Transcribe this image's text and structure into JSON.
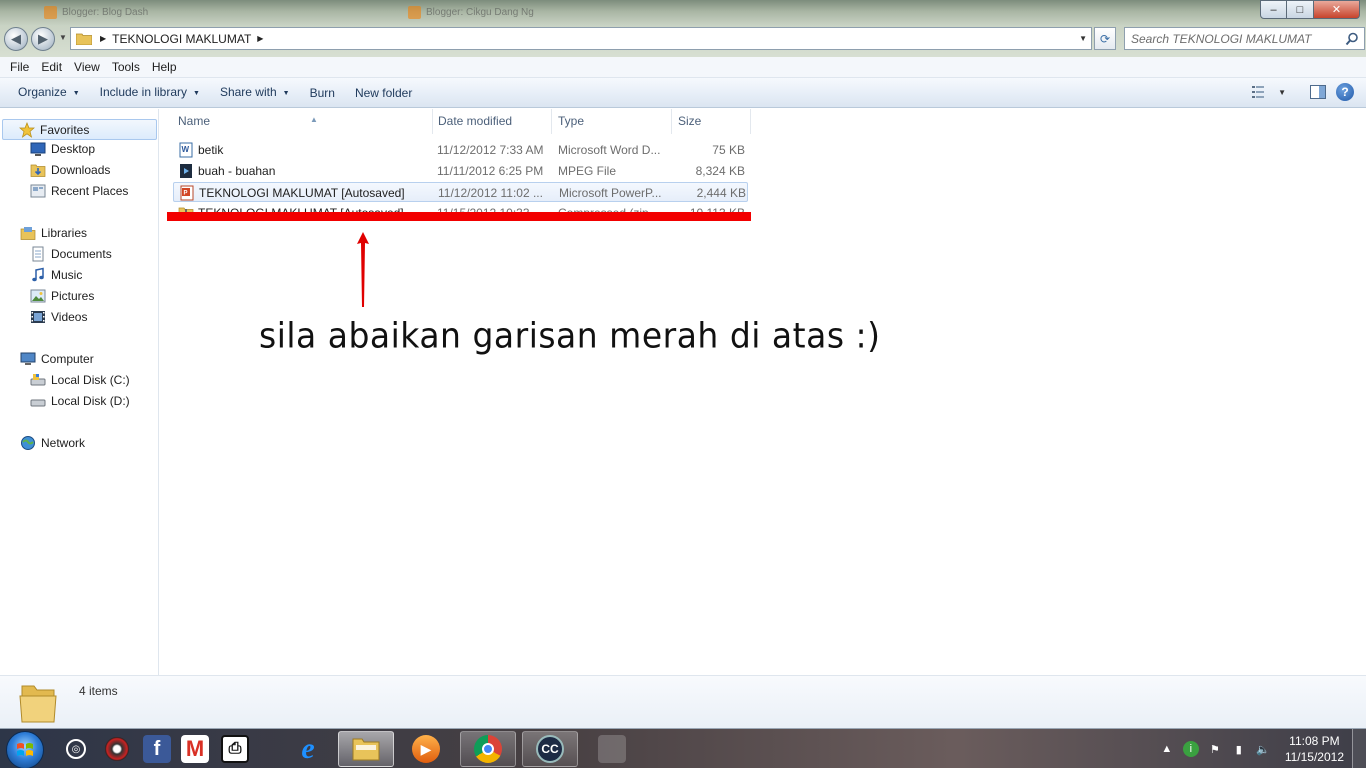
{
  "window": {
    "background_tabs": [
      "Blogger: Blog Dash",
      "Blogger: Cikgu Dang Ng"
    ],
    "controls": {
      "minimize": "–",
      "maximize": "□",
      "close": "✕"
    }
  },
  "address_bar": {
    "path": [
      "TEKNOLOGI MAKLUMAT"
    ],
    "search_placeholder": "Search TEKNOLOGI MAKLUMAT"
  },
  "menu": [
    "File",
    "Edit",
    "View",
    "Tools",
    "Help"
  ],
  "commands": {
    "organize": "Organize",
    "include_in_library": "Include in library",
    "share_with": "Share with",
    "burn": "Burn",
    "new_folder": "New folder"
  },
  "nav": {
    "favorites": "Favorites",
    "desktop": "Desktop",
    "downloads": "Downloads",
    "recent_places": "Recent Places",
    "libraries": "Libraries",
    "documents": "Documents",
    "music": "Music",
    "pictures": "Pictures",
    "videos": "Videos",
    "computer": "Computer",
    "local_c": "Local Disk (C:)",
    "local_d": "Local Disk (D:)",
    "network": "Network"
  },
  "columns": {
    "name": "Name",
    "date": "Date modified",
    "type": "Type",
    "size": "Size"
  },
  "files": [
    {
      "name": "betik",
      "date": "11/12/2012 7:33 AM",
      "type": "Microsoft Word D...",
      "size": "75 KB",
      "icon": "word-doc-icon"
    },
    {
      "name": "buah - buahan",
      "date": "11/11/2012 6:25 PM",
      "type": "MPEG File",
      "size": "8,324 KB",
      "icon": "video-file-icon"
    },
    {
      "name": "TEKNOLOGI MAKLUMAT [Autosaved]",
      "date": "11/12/2012 11:02 ...",
      "type": "Microsoft PowerP...",
      "size": "2,444 KB",
      "icon": "powerpoint-icon"
    },
    {
      "name": "TEKNOLOGI MAKLUMAT [Autosaved]",
      "date": "11/15/2012 10:33 ...",
      "type": "Compressed (zip...",
      "size": "10,113 KB",
      "icon": "zip-folder-icon"
    }
  ],
  "annotation_text": "sila abaikan garisan merah di atas :)",
  "details": {
    "count": "4 items"
  },
  "taskbar": {
    "clock_time": "11:08 PM",
    "clock_date": "11/15/2012"
  },
  "colors": {
    "highlight_red": "#f20000",
    "selection_border": "#b8d0ee",
    "command_text": "#1e395b"
  }
}
